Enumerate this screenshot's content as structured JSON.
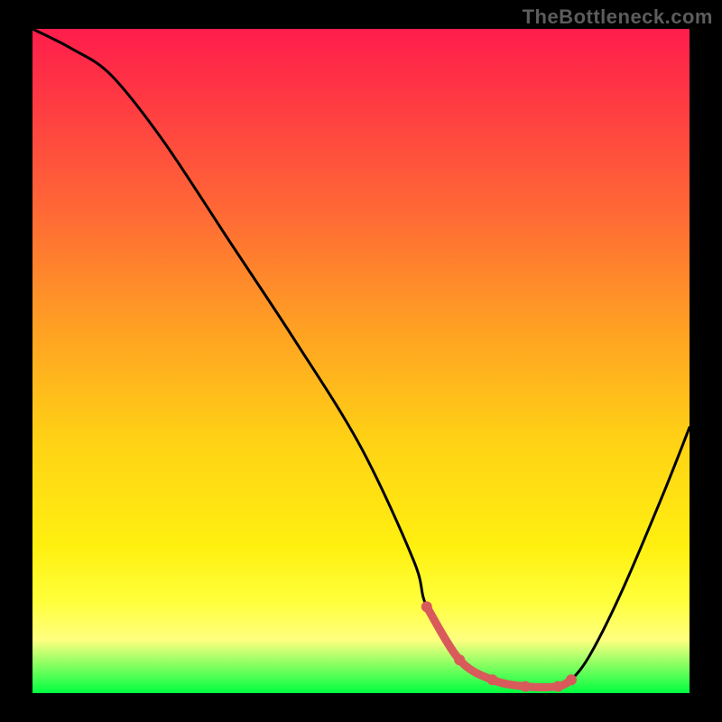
{
  "watermark": "TheBottleneck.com",
  "chart_data": {
    "type": "line",
    "title": "",
    "xlabel": "",
    "ylabel": "",
    "xlim": [
      0,
      100
    ],
    "ylim": [
      0,
      100
    ],
    "grid": false,
    "series": [
      {
        "name": "bottleneck-curve",
        "x": [
          0,
          6,
          12,
          20,
          30,
          40,
          50,
          58,
          60,
          65,
          70,
          75,
          80,
          82,
          85,
          90,
          96,
          100
        ],
        "values": [
          100,
          97,
          93,
          83,
          68,
          53,
          37,
          20,
          13,
          5,
          2,
          1,
          1,
          2,
          6,
          16,
          30,
          40
        ]
      },
      {
        "name": "bottom-highlight",
        "x": [
          60,
          65,
          70,
          75,
          80,
          82
        ],
        "values": [
          13,
          5,
          2,
          1,
          1,
          2
        ]
      }
    ],
    "background_gradient": {
      "top": "#ff1d4c",
      "mid": "#ffd215",
      "bottom": "#00ff40"
    },
    "curve_color": "#000000",
    "highlight_color": "#d85a5a"
  }
}
